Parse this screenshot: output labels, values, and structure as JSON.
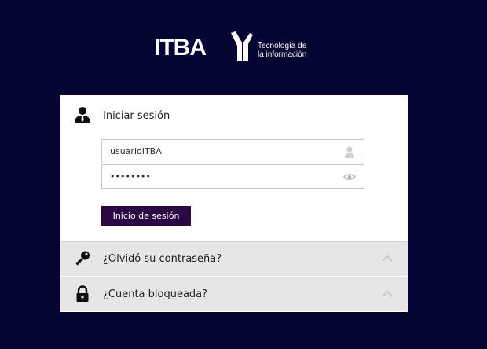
{
  "brand": {
    "name": "ITBA",
    "tagline_line1": "Tecnología de",
    "tagline_line2": "la información"
  },
  "login": {
    "title": "Iniciar sesión",
    "username_value": "usuarioITBA",
    "password_value": "password",
    "submit_label": "Inicio de sesión"
  },
  "sections": {
    "forgot_label": "¿Olvidó su contraseña?",
    "locked_label": "¿Cuenta bloqueada?"
  },
  "colors": {
    "background": "#050533",
    "button": "#2a0942",
    "section_bg": "#e6e6e6"
  }
}
